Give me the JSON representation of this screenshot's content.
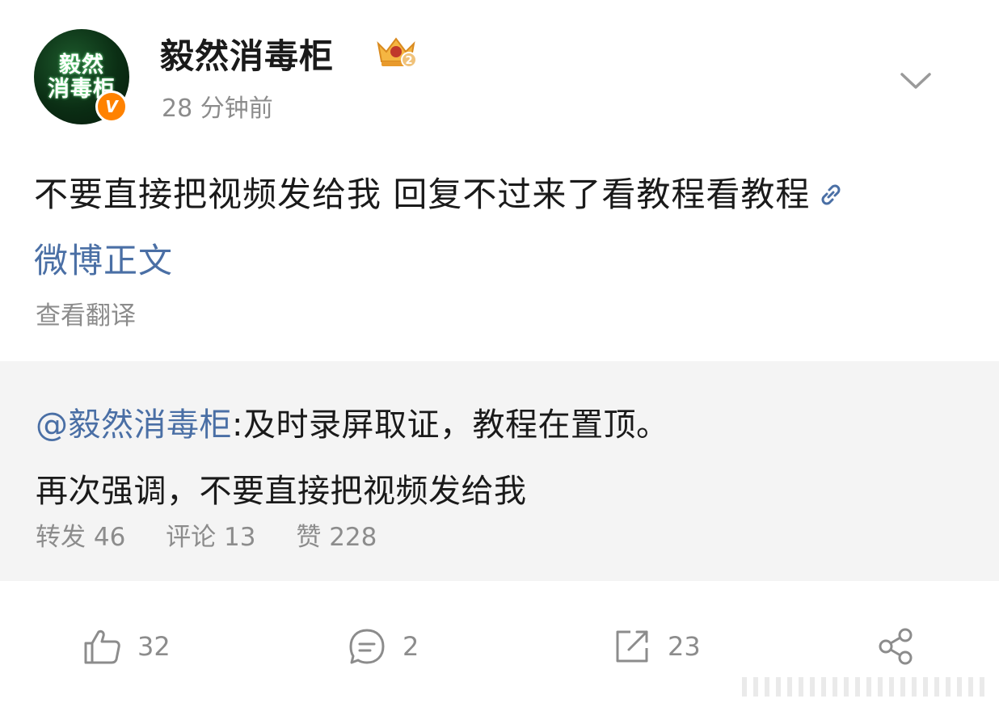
{
  "post": {
    "author": {
      "name": "毅然消毒柜",
      "avatar_lines": [
        "毅然",
        "消毒柜"
      ],
      "verified_mark": "V",
      "level_mark": "2"
    },
    "time": "28 分钟前",
    "text": "不要直接把视频发给我 回复不过来了看教程看教程",
    "link_label": "微博正文",
    "translate_label": "查看翻译"
  },
  "quote": {
    "mention": "@毅然消毒柜",
    "text_line1": ":及时录屏取证，教程在置顶。",
    "text_line2": "再次强调，不要直接把视频发给我",
    "stats": {
      "repost_label": "转发",
      "repost_count": "46",
      "comment_label": "评论",
      "comment_count": "13",
      "like_label": "赞",
      "like_count": "228"
    }
  },
  "actions": {
    "like_count": "32",
    "comment_count": "2",
    "repost_count": "23"
  },
  "icons": {
    "menu": "chevron-down-icon",
    "link": "link-icon",
    "like": "thumbs-up-icon",
    "comment": "comment-bubble-icon",
    "repost": "repost-icon",
    "share": "share-icon"
  },
  "colors": {
    "link": "#4a6fa5",
    "muted": "#8c8c8c",
    "quote_bg": "#f4f4f4",
    "verified": "#ff8200"
  }
}
